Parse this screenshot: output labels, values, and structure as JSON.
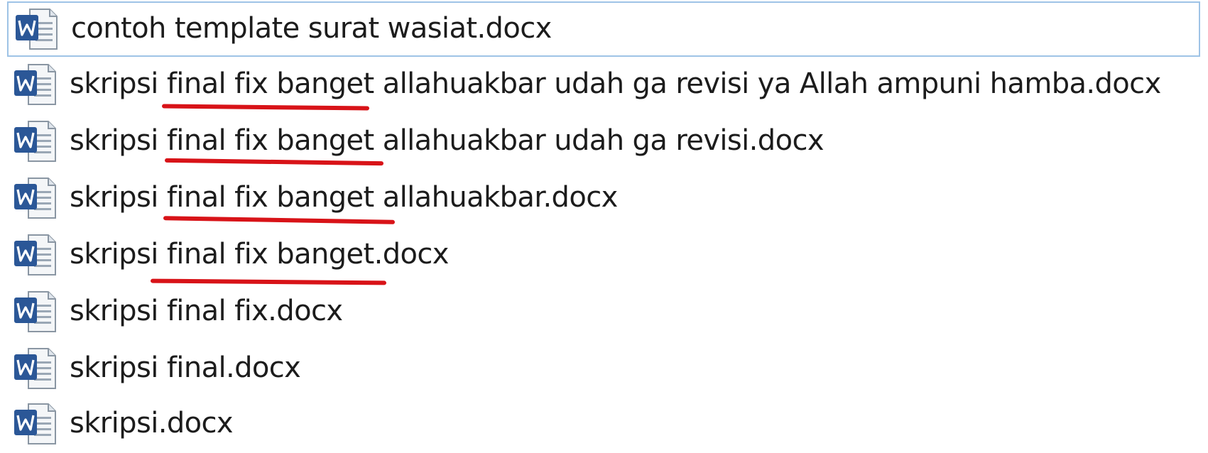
{
  "files": [
    {
      "name": "contoh template surat wasiat.docx",
      "icon": "word-document-icon",
      "selected": true
    },
    {
      "name": "skripsi final fix banget allahuakbar udah ga revisi ya Allah ampuni hamba.docx",
      "icon": "word-document-icon",
      "selected": false
    },
    {
      "name": "skripsi final fix banget allahuakbar udah ga revisi.docx",
      "icon": "word-document-icon",
      "selected": false
    },
    {
      "name": "skripsi final fix banget allahuakbar.docx",
      "icon": "word-document-icon",
      "selected": false
    },
    {
      "name": "skripsi final fix banget.docx",
      "icon": "word-document-icon",
      "selected": false
    },
    {
      "name": "skripsi final fix.docx",
      "icon": "word-document-icon",
      "selected": false
    },
    {
      "name": "skripsi final.docx",
      "icon": "word-document-icon",
      "selected": false
    },
    {
      "name": "skripsi.docx",
      "icon": "word-document-icon",
      "selected": false
    }
  ],
  "colors": {
    "selection_border": "#9ec3e6",
    "underline": "#d81318",
    "word_blue": "#2b5797"
  }
}
